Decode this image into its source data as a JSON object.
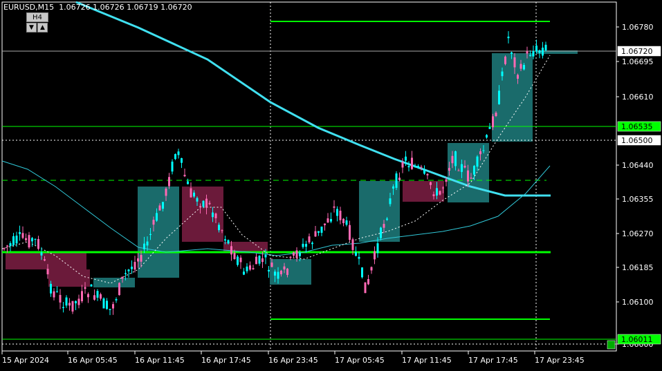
{
  "header": {
    "symbol_info": "EURUSD,M15  1.06726 1.06726 1.06719 1.06720",
    "timeframe_label": "H4",
    "down_arrow": "▼",
    "up_arrow": "▲"
  },
  "price_axis": {
    "ticks": [
      "1.06780",
      "1.06695",
      "1.06610",
      "1.06440",
      "1.06355",
      "1.06270",
      "1.06185",
      "1.06100",
      "1.06000"
    ],
    "labels": {
      "bid": "1.06720",
      "level_green": "1.06535",
      "level_dotted": "1.06500",
      "level_bottom": "1.06011"
    }
  },
  "time_axis": {
    "ticks": [
      "15 Apr 2024",
      "16 Apr 05:45",
      "16 Apr 11:45",
      "16 Apr 17:45",
      "16 Apr 23:45",
      "17 Apr 05:45",
      "17 Apr 11:45",
      "17 Apr 17:45",
      "17 Apr 23:45"
    ]
  },
  "colors": {
    "background": "#000000",
    "grid": "#ffffff",
    "bull_candle": "#00ffff",
    "bear_candle": "#ff69b4",
    "ma_slow": "#40e0f0",
    "ma_thin": "#30c8d8",
    "level_line": "#00ff00",
    "bull_box": "#1a6b6b",
    "bear_box": "#6b1a3a"
  },
  "chart_data": {
    "type": "candlestick",
    "symbol": "EURUSD",
    "timeframe": "M15",
    "ohlc_last": {
      "open": 1.06726,
      "high": 1.06726,
      "low": 1.06719,
      "close": 1.0672
    },
    "y_ticks": [
      1.0678,
      1.06695,
      1.0661,
      1.0644,
      1.06355,
      1.0627,
      1.06185,
      1.061,
      1.06
    ],
    "horizontal_levels": [
      1.06535,
      1.065,
      1.06011,
      1.0672
    ],
    "x_ticks": [
      "15 Apr 2024",
      "16 Apr 05:45",
      "16 Apr 11:45",
      "16 Apr 17:45",
      "16 Apr 23:45",
      "17 Apr 05:45",
      "17 Apr 11:45",
      "17 Apr 17:45",
      "17 Apr 23:45"
    ]
  }
}
